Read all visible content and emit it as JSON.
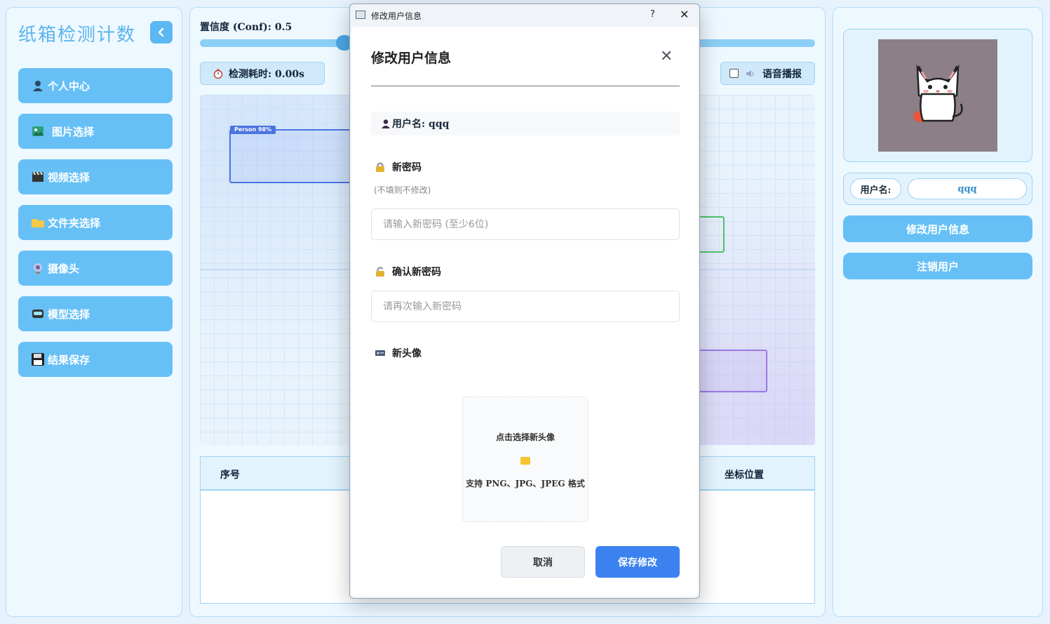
{
  "app": {
    "title": "纸箱检测计数"
  },
  "sidebar": {
    "items": [
      {
        "label": "个人中心",
        "icon": "person-icon"
      },
      {
        "label": "图片选择",
        "icon": "image-icon"
      },
      {
        "label": "视频选择",
        "icon": "clapperboard-icon"
      },
      {
        "label": "文件夹选择",
        "icon": "folder-icon"
      },
      {
        "label": "摄像头",
        "icon": "webcam-icon"
      },
      {
        "label": "模型选择",
        "icon": "robot-icon"
      },
      {
        "label": "结果保存",
        "icon": "floppy-disk-icon"
      }
    ]
  },
  "main": {
    "conf_label": "置信度 (Conf): 0.5",
    "conf_value": 0.5,
    "time_label": "检测耗时: 0.00s",
    "voice_label": "语音播报",
    "voice_checked": false,
    "detections": [
      {
        "label": "Person 98%",
        "color": "#4b74e0"
      }
    ],
    "table": {
      "headers": [
        "序号",
        "坐标位置"
      ]
    }
  },
  "right": {
    "username_label": "用户名:",
    "username_value": "qqq",
    "edit_button": "修改用户信息",
    "logout_button": "注销用户"
  },
  "dialog": {
    "window_title": "修改用户信息",
    "help": "?",
    "heading": "修改用户信息",
    "username_line": "用户名: qqq",
    "new_password_label": "新密码",
    "new_password_hint": "(不填则不修改)",
    "new_password_placeholder": "请输入新密码 (至少6位)",
    "confirm_password_label": "确认新密码",
    "confirm_password_placeholder": "请再次输入新密码",
    "avatar_label": "新头像",
    "upload_title": "点击选择新头像",
    "upload_formats": "支持 PNG、JPG、JPEG 格式",
    "cancel": "取消",
    "save": "保存修改"
  },
  "colors": {
    "accent": "#66c0f6",
    "primary_button": "#3b82f0",
    "title": "#5ab4ec"
  }
}
